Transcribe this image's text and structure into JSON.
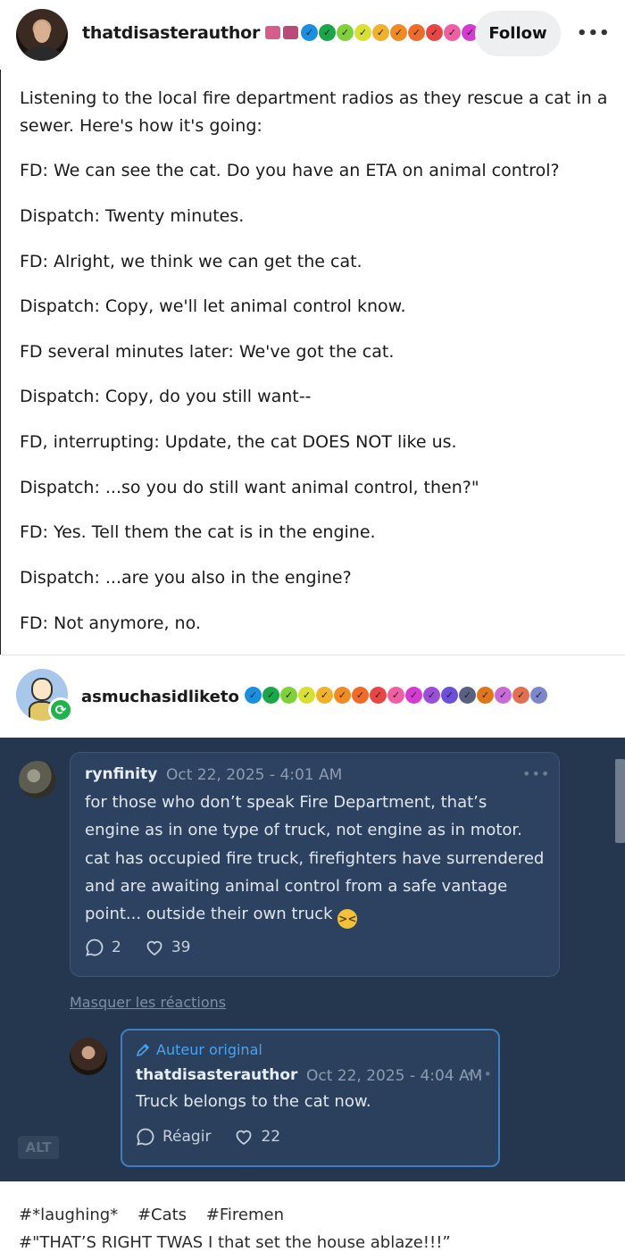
{
  "post": {
    "author": "thatdisasterauthor",
    "follow_label": "Follow",
    "more_icon": "more-horizontal-icon",
    "badges": [
      {
        "color": "#d55d8c",
        "kind": "typewriter"
      },
      {
        "color": "#b94b7b",
        "kind": "typewriter"
      },
      {
        "color": "#1a8fe0",
        "kind": "check"
      },
      {
        "color": "#1ca64c",
        "kind": "check"
      },
      {
        "color": "#7fd13b",
        "kind": "check"
      },
      {
        "color": "#d8e033",
        "kind": "check"
      },
      {
        "color": "#f2b12a",
        "kind": "check"
      },
      {
        "color": "#f08a24",
        "kind": "check"
      },
      {
        "color": "#ef6b2a",
        "kind": "check"
      },
      {
        "color": "#e84545",
        "kind": "check"
      },
      {
        "color": "#ef5fa3",
        "kind": "check"
      },
      {
        "color": "#d43cd1",
        "kind": "check"
      }
    ],
    "lines": [
      "Listening to the local fire department radios as they rescue a cat in a sewer. Here's how it's going:",
      "FD: We can see the cat. Do you have an ETA on animal control?",
      "Dispatch: Twenty minutes.",
      "FD: Alright, we think we can get the cat.",
      "Dispatch: Copy, we'll let animal control know.",
      "FD several minutes later: We've got the cat.",
      "Dispatch: Copy, do you still want--",
      "FD, interrupting: Update, the cat DOES NOT like us.",
      "Dispatch: ...so you do still want animal control, then?\"",
      "FD: Yes. Tell them the cat is in the engine.",
      "Dispatch: ...are you also in the engine?",
      "FD: Not anymore, no."
    ]
  },
  "reblog": {
    "author": "asmuchasidliketo",
    "reblog_icon": "reblog-icon",
    "badges": [
      {
        "color": "#1a8fe0"
      },
      {
        "color": "#1ca64c"
      },
      {
        "color": "#7fd13b"
      },
      {
        "color": "#d8e033"
      },
      {
        "color": "#f2b12a"
      },
      {
        "color": "#f08a24"
      },
      {
        "color": "#ef6b2a"
      },
      {
        "color": "#e84545"
      },
      {
        "color": "#ef5fa3"
      },
      {
        "color": "#d43cd1"
      },
      {
        "color": "#9b4fd6"
      },
      {
        "color": "#6c4fd6"
      },
      {
        "color": "#5a6080"
      },
      {
        "color": "#e0761c"
      },
      {
        "color": "#c96bd6"
      },
      {
        "color": "#e07050"
      },
      {
        "color": "#7d86c8"
      }
    ]
  },
  "comment": {
    "author": "rynfinity",
    "date": "Oct 22, 2025 - 4:01 AM",
    "text": "for those who don’t speak Fire Department, that’s engine as in one type of truck, not engine as in motor. cat has occupied fire truck, firefighters have surrendered and are awaiting animal control from a safe vantage point... outside their own truck",
    "replies": "2",
    "likes": "39"
  },
  "hide_reactions": "Masquer les réactions",
  "reply": {
    "op_label": "Auteur original",
    "author": "thatdisasterauthor",
    "date": "Oct 22, 2025 - 4:04 AM",
    "text": "Truck belongs to the cat now.",
    "reply_label": "Réagir",
    "likes": "22"
  },
  "alt_label": "ALT",
  "tags": [
    "#*laughing*",
    "#Cats",
    "#Firemen",
    "#\"THAT’S RIGHT TWAS I that set the house ablaze!!!”"
  ]
}
